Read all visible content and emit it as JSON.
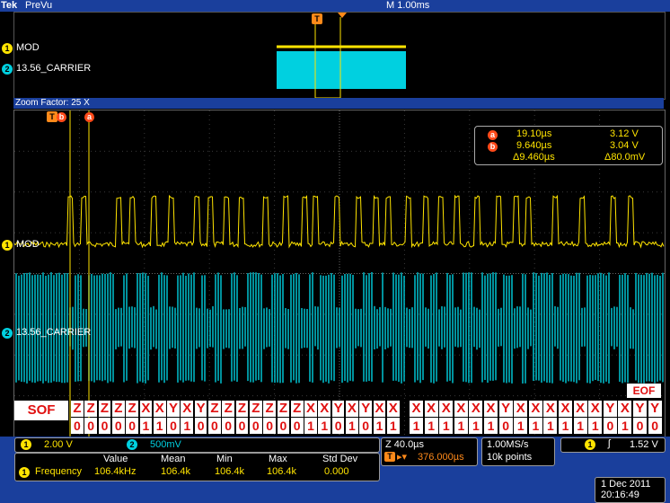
{
  "header": {
    "brand": "Tek",
    "mode": "PreVu",
    "timebase": "M 1.00ms"
  },
  "channels": [
    {
      "num": "1",
      "label": "MOD",
      "color": "#ffe400"
    },
    {
      "num": "2",
      "label": "13.56_CARRIER",
      "color": "#00d0e0"
    }
  ],
  "zoom": {
    "label": "Zoom Factor: 25 X"
  },
  "cursor_markers": {
    "trigger": "T",
    "b": "b",
    "a": "a"
  },
  "cursor_readout": {
    "a_label": "a",
    "a_time": "19.10µs",
    "a_volt": "3.12 V",
    "b_label": "b",
    "b_time": "9.640µs",
    "b_volt": "3.04 V",
    "delta_time": "Δ9.460µs",
    "delta_volt": "Δ80.0mV"
  },
  "decode": {
    "sof": "SOF",
    "eof": "EOF",
    "group1_top": [
      "Z",
      "Z",
      "Z",
      "Z",
      "Z",
      "X",
      "X",
      "Y",
      "X",
      "Y",
      "Z",
      "Z",
      "Z",
      "Z",
      "Z",
      "Z",
      "Z",
      "X",
      "X",
      "Y",
      "X",
      "Y",
      "X",
      "X"
    ],
    "group1_bottom": [
      "0",
      "0",
      "0",
      "0",
      "0",
      "1",
      "1",
      "0",
      "1",
      "0",
      "0",
      "0",
      "0",
      "0",
      "0",
      "0",
      "0",
      "1",
      "1",
      "0",
      "1",
      "0",
      "1",
      "1"
    ],
    "group2_top": [
      "X",
      "X",
      "X",
      "X",
      "X",
      "X",
      "Y",
      "X",
      "X",
      "X",
      "X",
      "X",
      "X",
      "Y",
      "X",
      "Y",
      "Y"
    ],
    "group2_bottom": [
      "1",
      "1",
      "1",
      "1",
      "1",
      "1",
      "0",
      "1",
      "1",
      "1",
      "1",
      "1",
      "1",
      "0",
      "1",
      "0",
      "0"
    ]
  },
  "bottom": {
    "ch1_scale": "2.00 V",
    "ch2_scale": "500mV",
    "zoom_time": "Z 40.0µs",
    "trigger_pos": "376.000µs",
    "sample_rate": "1.00MS/s",
    "record": "10k points",
    "trig_ch": "1",
    "trig_level": "1.52 V",
    "meas_headers": [
      "Value",
      "Mean",
      "Min",
      "Max",
      "Std Dev"
    ],
    "meas_name": "Frequency",
    "meas_values": [
      "106.4kHz",
      "106.4k",
      "106.4k",
      "106.4k",
      "0.000"
    ],
    "date": "1 Dec 2011",
    "time": "20:16:49"
  }
}
